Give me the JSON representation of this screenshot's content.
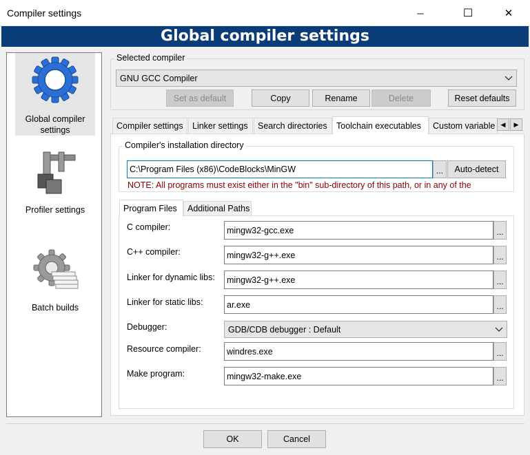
{
  "window": {
    "title": "Compiler settings",
    "banner": "Global compiler settings",
    "minimize_glyph": "─",
    "maximize_glyph": "☐",
    "close_glyph": "✕"
  },
  "sidebar": {
    "items": [
      {
        "label": "Global compiler settings",
        "icon": "gear-icon",
        "selected": true
      },
      {
        "label": "Profiler settings",
        "icon": "caliper-icon",
        "selected": false
      },
      {
        "label": "Batch builds",
        "icon": "batch-gear-icon",
        "selected": false
      }
    ]
  },
  "compiler_select": {
    "group_title": "Selected compiler",
    "selected": "GNU GCC Compiler",
    "buttons": {
      "set_default": "Set as default",
      "copy": "Copy",
      "rename": "Rename",
      "delete": "Delete",
      "reset": "Reset defaults"
    }
  },
  "tabs": [
    "Compiler settings",
    "Linker settings",
    "Search directories",
    "Toolchain executables",
    "Custom variable"
  ],
  "active_tab": "Toolchain executables",
  "install_dir": {
    "group_title": "Compiler's installation directory",
    "value": "C:\\Program Files (x86)\\CodeBlocks\\MinGW",
    "browse_label": "...",
    "autodetect_label": "Auto-detect",
    "note": "NOTE: All programs must exist either in the \"bin\" sub-directory of this path, or in any of the"
  },
  "subtabs": [
    "Program Files",
    "Additional Paths"
  ],
  "programs": {
    "c_compiler": {
      "label": "C compiler:",
      "value": "mingw32-gcc.exe"
    },
    "cpp_compiler": {
      "label": "C++ compiler:",
      "value": "mingw32-g++.exe"
    },
    "linker_dynamic": {
      "label": "Linker for dynamic libs:",
      "value": "mingw32-g++.exe"
    },
    "linker_static": {
      "label": "Linker for static libs:",
      "value": "ar.exe"
    },
    "debugger": {
      "label": "Debugger:",
      "value": "GDB/CDB debugger : Default"
    },
    "resource_compiler": {
      "label": "Resource compiler:",
      "value": "windres.exe"
    },
    "make_program": {
      "label": "Make program:",
      "value": "mingw32-make.exe"
    },
    "browse_label": "..."
  },
  "footer": {
    "ok": "OK",
    "cancel": "Cancel"
  },
  "colors": {
    "banner": "#0a3d78",
    "note": "#8b0000",
    "focus": "#0078d7"
  }
}
